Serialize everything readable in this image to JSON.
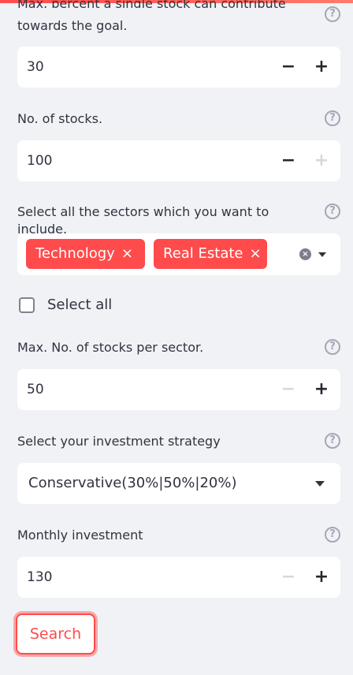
{
  "goal_contribution": {
    "label_partial": "Max. percent a single stock can contribute",
    "label_tail": "towards the goal.",
    "value": "30"
  },
  "num_stocks": {
    "label": "No. of stocks.",
    "value": "100"
  },
  "sectors": {
    "label": "Select all the sectors which you want to include.",
    "tags": [
      "Technology",
      "Real Estate"
    ],
    "tag_remove_glyph": "×",
    "clear_glyph": "×"
  },
  "select_all": {
    "label": "Select all",
    "checked": false
  },
  "max_per_sector": {
    "label": "Max. No. of stocks per sector.",
    "value": "50"
  },
  "strategy": {
    "label": "Select your investment strategy",
    "value": "Conservative(30%|50%|20%)"
  },
  "monthly_investment": {
    "label": "Monthly investment",
    "value": "130"
  },
  "controls": {
    "minus": "−",
    "plus": "+",
    "help": "?"
  },
  "search_button": {
    "label": "Search"
  },
  "icons": {
    "help": "help-circle-icon",
    "remove": "close-icon",
    "dropdown": "chevron-down-icon"
  },
  "colors": {
    "accent": "#ff4b4b",
    "background": "#f0f2f6",
    "text": "#31333f",
    "muted": "#a3a8b4"
  }
}
